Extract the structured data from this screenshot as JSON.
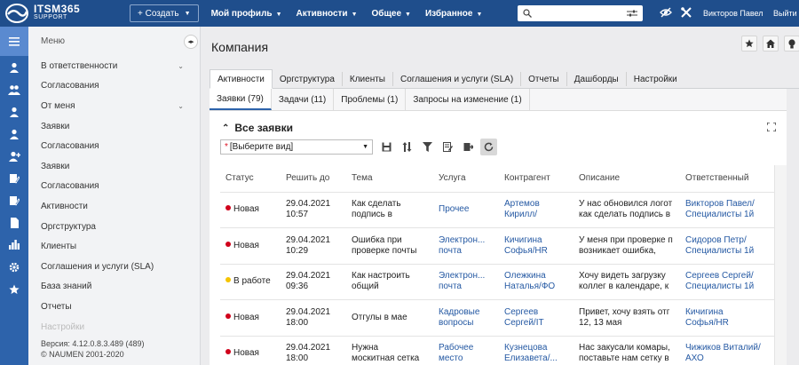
{
  "app": {
    "logo_line1": "ITSM365",
    "logo_line2": "SUPPORT"
  },
  "topbar": {
    "create_label": "+ Создать",
    "menus": [
      "Мой профиль",
      "Активности",
      "Общее",
      "Избранное"
    ],
    "user_name": "Викторов Павел",
    "logout_label": "Выйти"
  },
  "sidebar": {
    "heading": "Меню",
    "items": [
      {
        "label": "В ответственности",
        "chevron": true
      },
      {
        "label": "Согласования",
        "chevron": false
      },
      {
        "label": "От меня",
        "chevron": true
      },
      {
        "label": "Заявки",
        "chevron": false
      },
      {
        "label": "Согласования",
        "chevron": false
      },
      {
        "label": "Заявки",
        "chevron": false
      },
      {
        "label": "Согласования",
        "chevron": false
      },
      {
        "label": "Активности",
        "chevron": false
      },
      {
        "label": "Оргструктура",
        "chevron": false
      },
      {
        "label": "Клиенты",
        "chevron": false
      },
      {
        "label": "Соглашения и услуги (SLA)",
        "chevron": false
      },
      {
        "label": "База знаний",
        "chevron": false
      },
      {
        "label": "Отчеты",
        "chevron": false
      },
      {
        "label": "Настройки",
        "chevron": false
      }
    ],
    "version": "Версия: 4.12.0.8.3.489 (489)",
    "copyright": "© NAUMEN 2001-2020"
  },
  "page": {
    "title": "Компания",
    "tabs": [
      "Активности",
      "Оргструктура",
      "Клиенты",
      "Соглашения и услуги (SLA)",
      "Отчеты",
      "Дашборды",
      "Настройки"
    ],
    "subtabs": [
      "Заявки (79)",
      "Задачи (11)",
      "Проблемы (1)",
      "Запросы на изменение (1)"
    ],
    "list_title": "Все заявки",
    "view_placeholder": "[Выберите вид]"
  },
  "colors": {
    "new": "#d0021b",
    "in_work": "#f5c400",
    "topbar": "#1f4e8c",
    "iconbar": "#2d63ab"
  },
  "table": {
    "headers": [
      "Статус",
      "Решить до",
      "Тема",
      "Услуга",
      "Контрагент",
      "Описание",
      "Ответственный"
    ],
    "rows": [
      {
        "status": "Новая",
        "status_color": "#d0021b",
        "date": "29.04.2021",
        "time": "10:57",
        "subject1": "Как сделать",
        "subject2": "подпись в",
        "service1": "Прочее",
        "service2": "",
        "contractor1": "Артемов",
        "contractor2": "Кирилл/",
        "desc1": "У нас обновился логот",
        "desc2": "как сделать подпись в",
        "owner1": "Викторов Павел/",
        "owner2": "Специалисты 1й"
      },
      {
        "status": "Новая",
        "status_color": "#d0021b",
        "date": "29.04.2021",
        "time": "10:29",
        "subject1": "Ошибка при",
        "subject2": "проверке почты",
        "service1": "Электрон...",
        "service2": "почта",
        "contractor1": "Кичигина",
        "contractor2": "Софья/HR",
        "desc1": "У меня при проверке п",
        "desc2": "возникает ошибка,",
        "owner1": "Сидоров Петр/",
        "owner2": "Специалисты 1й"
      },
      {
        "status": "В работе",
        "status_color": "#f5c400",
        "date": "29.04.2021",
        "time": "09:36",
        "subject1": "Как настроить",
        "subject2": "общий",
        "service1": "Электрон...",
        "service2": "почта",
        "contractor1": "Олежкина",
        "contractor2": "Наталья/ФО",
        "desc1": "Хочу видеть загрузку",
        "desc2": "коллег в календаре, к",
        "owner1": "Сергеев Сергей/",
        "owner2": "Специалисты 1й"
      },
      {
        "status": "Новая",
        "status_color": "#d0021b",
        "date": "29.04.2021",
        "time": "18:00",
        "subject1": "Отгулы в мае",
        "subject2": "",
        "service1": "Кадровые",
        "service2": "вопросы",
        "contractor1": "Сергеев",
        "contractor2": "Сергей/IT",
        "desc1": "Привет, хочу взять отг",
        "desc2": "12, 13 мая",
        "owner1": "Кичигина",
        "owner2": "Софья/HR"
      },
      {
        "status": "Новая",
        "status_color": "#d0021b",
        "date": "29.04.2021",
        "time": "18:00",
        "subject1": "Нужна",
        "subject2": "москитная сетка",
        "service1": "Рабочее",
        "service2": "место",
        "contractor1": "Кузнецова",
        "contractor2": "Елизавета/...",
        "desc1": "Нас закусали комары,",
        "desc2": "поставьте нам сетку в",
        "owner1": "Чижиков Виталий/",
        "owner2": "АХО"
      }
    ]
  }
}
